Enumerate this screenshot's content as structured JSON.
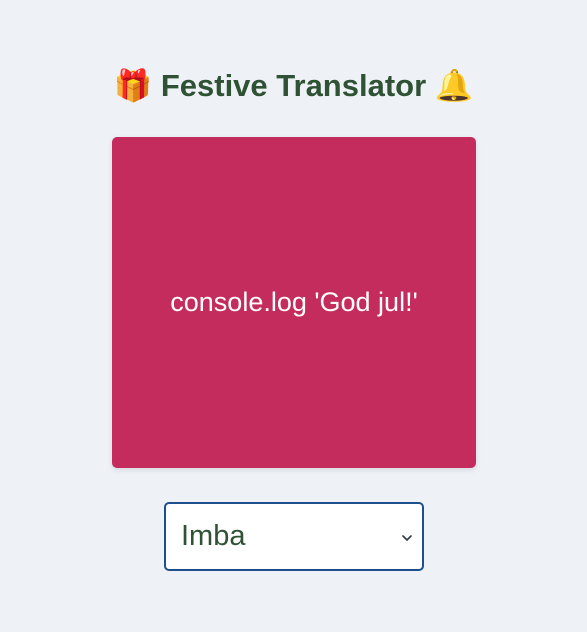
{
  "header": {
    "icon_left": "🎁",
    "icon_left_name": "gift-icon",
    "title": "Festive Translator",
    "icon_right": "🔔",
    "icon_right_name": "bell-icon"
  },
  "output": {
    "text": "console.log 'God jul!'",
    "background": "#c42c5d"
  },
  "language_select": {
    "selected": "Imba",
    "chevron": "chevron-down-icon"
  },
  "colors": {
    "page_bg": "#eef2f6",
    "title": "#2e5233",
    "select_border": "#1d4f8c"
  }
}
